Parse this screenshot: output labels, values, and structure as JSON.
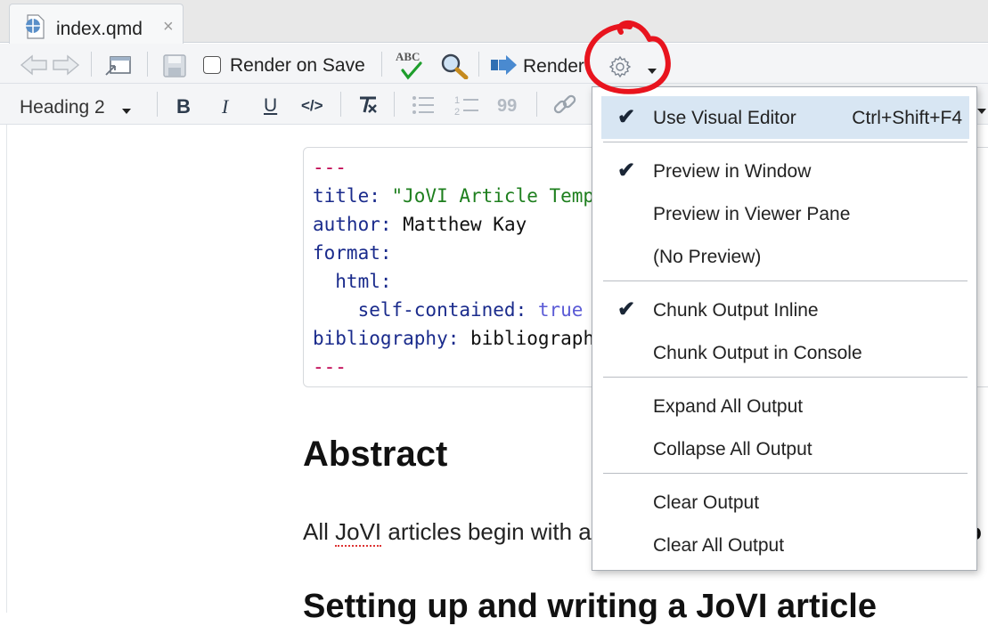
{
  "tab": {
    "name": "index.qmd",
    "close_glyph": "×"
  },
  "toolbar1": {
    "render_on_save_label": "Render on Save",
    "spellcheck_text": "ABC",
    "render_label": "Render"
  },
  "toolbar2": {
    "heading_select": "Heading 2",
    "bold": "B",
    "italic": "I",
    "underline": "U",
    "code": "</>",
    "quote": "99"
  },
  "code": {
    "delim_open": "---",
    "title_key": "title:",
    "title_value": " \"JoVI Article Template\"",
    "author_key": "author:",
    "author_value": " Matthew Kay",
    "format_key": "format:",
    "html_key": "  html:",
    "selfcontained_key": "    self-contained:",
    "selfcontained_value": " true",
    "bibliography_key": "bibliography:",
    "bibliography_value": " bibliography.bib",
    "delim_close": "---"
  },
  "document": {
    "heading_abstract": "Abstract",
    "para_prefix": "All ",
    "para_misspelled": "JoVI",
    "para_suffix": " articles begin with an abstract",
    "para_trailing": "o",
    "heading_setup": "Setting up and writing a JoVI article"
  },
  "menu": {
    "items": [
      {
        "label": "Use Visual Editor",
        "shortcut": "Ctrl+Shift+F4",
        "checked": true,
        "highlighted": true
      },
      {
        "label": "Preview in Window",
        "checked": true
      },
      {
        "label": "Preview in Viewer Pane",
        "checked": false
      },
      {
        "label": "(No Preview)",
        "checked": false
      },
      {
        "label": "Chunk Output Inline",
        "checked": true
      },
      {
        "label": "Chunk Output in Console",
        "checked": false
      },
      {
        "label": "Expand All Output",
        "checked": false
      },
      {
        "label": "Collapse All Output",
        "checked": false
      },
      {
        "label": "Clear Output",
        "checked": false
      },
      {
        "label": "Clear All Output",
        "checked": false
      }
    ],
    "check_glyph": "✔"
  },
  "colors": {
    "annotation": "#e8141e",
    "menu_highlight": "#d8e6f3",
    "yaml_key": "#1a2b8c",
    "yaml_string": "#1e7f1e",
    "yaml_delim": "#c0004f"
  }
}
